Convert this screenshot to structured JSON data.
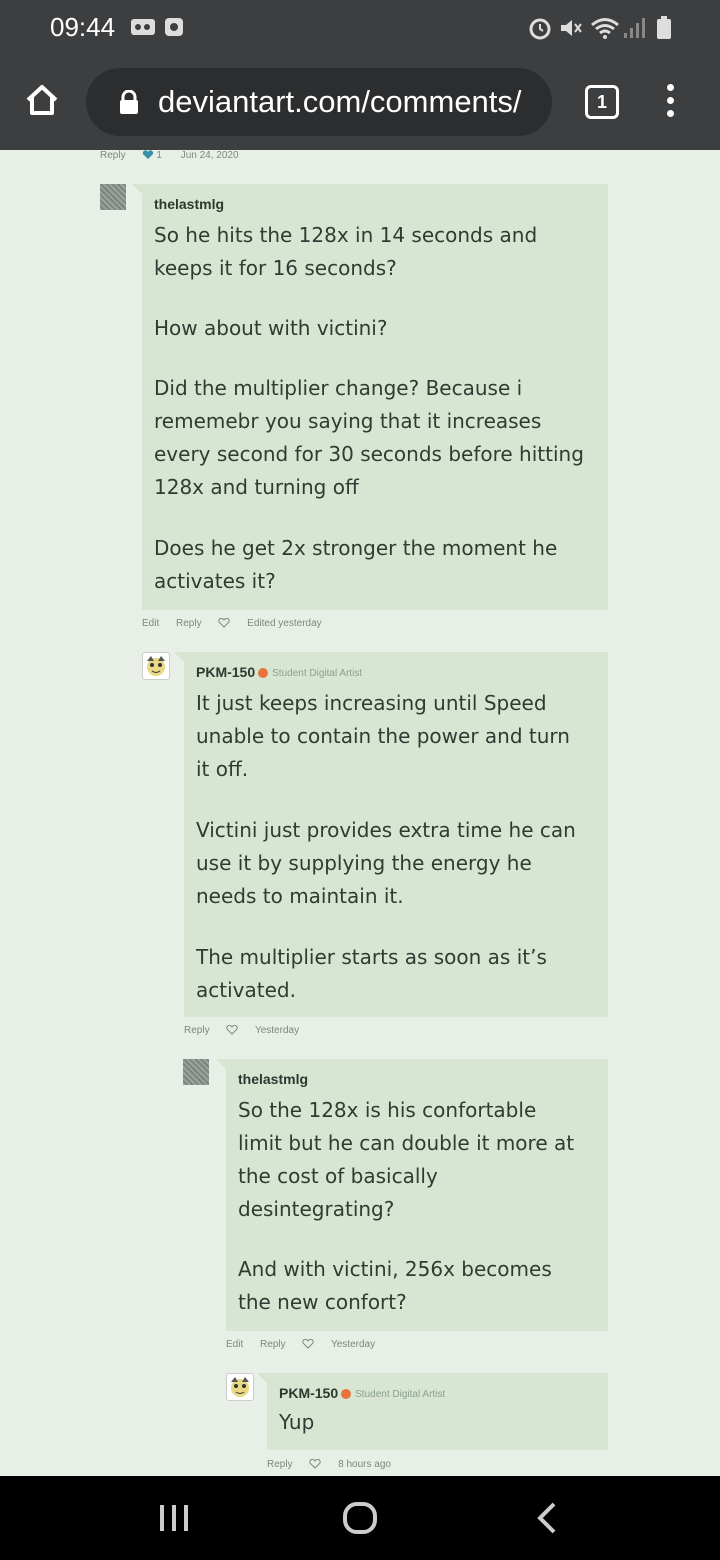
{
  "status": {
    "time": "09:44"
  },
  "browser": {
    "url": "deviantart.com/comments/",
    "tab_count": "1"
  },
  "top_meta": {
    "reply": "Reply",
    "likes": "1",
    "date": "Jun 24, 2020"
  },
  "comments": [
    {
      "user": "thelastmlg",
      "paragraphs": [
        [
          "So he hits the 128x in 14 seconds and",
          "keeps it for 16 seconds?"
        ],
        [
          "How about with victini?"
        ],
        [
          "Did the multiplier change? Because i",
          "rememebr you saying that it increases",
          "every second for 30 seconds before hitting",
          "128x and turning off"
        ],
        [
          "Does he get 2x stronger the moment he",
          "activates it?"
        ]
      ],
      "actions": {
        "edit": "Edit",
        "reply": "Reply",
        "time": "Edited yesterday"
      }
    },
    {
      "user": "PKM-150",
      "role": "Student Digital Artist",
      "paragraphs": [
        [
          "It just keeps increasing until Speed",
          "unable to contain the power and turn",
          "it off."
        ],
        [
          "Victini just provides extra time he can",
          "use it by supplying the energy he",
          "needs to maintain it."
        ],
        [
          "The multiplier starts as soon as it’s",
          "activated."
        ]
      ],
      "actions": {
        "reply": "Reply",
        "time": "Yesterday"
      }
    },
    {
      "user": "thelastmlg",
      "paragraphs": [
        [
          "So the 128x is his confortable",
          "limit but he can double it more at",
          "the cost of basically",
          "desintegrating?"
        ],
        [
          "And with victini, 256x becomes",
          "the new confort?"
        ]
      ],
      "actions": {
        "edit": "Edit",
        "reply": "Reply",
        "time": "Yesterday"
      }
    },
    {
      "user": "PKM-150",
      "role": "Student Digital Artist",
      "paragraphs": [
        [
          "Yup"
        ]
      ],
      "actions": {
        "reply": "Reply",
        "time": "8 hours ago"
      }
    }
  ]
}
